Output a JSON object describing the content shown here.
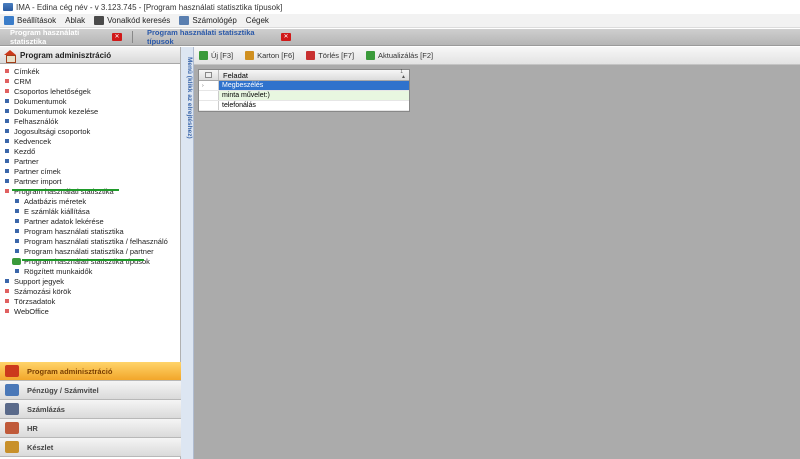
{
  "window": {
    "title": "IMA - Edina cég név - v 3.123.745 - [Program használati statisztika típusok]"
  },
  "menubar": {
    "items": [
      {
        "label": "Beállítások",
        "icon": "wrench-icon",
        "color": "#3b7dc9"
      },
      {
        "label": "Ablak",
        "icon": "",
        "color": ""
      },
      {
        "label": "Vonalkód keresés",
        "icon": "barcode-icon",
        "color": "#4a4a4a"
      },
      {
        "label": "Számológép",
        "icon": "calculator-icon",
        "color": "#5a7fb0"
      },
      {
        "label": "Cégek",
        "icon": "",
        "color": ""
      }
    ]
  },
  "tabs": [
    {
      "label": "Program használati statisztika",
      "active": false
    },
    {
      "label": "Program használati statisztika típusok",
      "active": true
    }
  ],
  "left_panel": {
    "title": "Program adminisztráció",
    "tree": [
      {
        "label": "Címkék",
        "level": 0,
        "bullet": "red"
      },
      {
        "label": "CRM",
        "level": 0,
        "bullet": "red"
      },
      {
        "label": "Csoportos lehetőségek",
        "level": 0,
        "bullet": "red"
      },
      {
        "label": "Dokumentumok",
        "level": 0,
        "bullet": "blue"
      },
      {
        "label": "Dokumentumok kezelése",
        "level": 0,
        "bullet": "blue"
      },
      {
        "label": "Felhasználók",
        "level": 0,
        "bullet": "blue"
      },
      {
        "label": "Jogosultsági csoportok",
        "level": 0,
        "bullet": "blue"
      },
      {
        "label": "Kedvencek",
        "level": 0,
        "bullet": "blue"
      },
      {
        "label": "Kezdő",
        "level": 0,
        "bullet": "blue"
      },
      {
        "label": "Partner",
        "level": 0,
        "bullet": "blue"
      },
      {
        "label": "Partner címek",
        "level": 0,
        "bullet": "blue"
      },
      {
        "label": "Partner import",
        "level": 0,
        "bullet": "blue"
      },
      {
        "label": "Program használati statisztika",
        "level": 0,
        "bullet": "red"
      },
      {
        "label": "Adatbázis méretek",
        "level": 1,
        "bullet": "blue"
      },
      {
        "label": "E számlák kiállítása",
        "level": 1,
        "bullet": "blue"
      },
      {
        "label": "Partner adatok lekérése",
        "level": 1,
        "bullet": "blue"
      },
      {
        "label": "Program használati statisztika",
        "level": 1,
        "bullet": "blue"
      },
      {
        "label": "Program használati statisztika / felhasználó",
        "level": 1,
        "bullet": "blue"
      },
      {
        "label": "Program használati statisztika / partner",
        "level": 1,
        "bullet": "blue"
      },
      {
        "label": "Program használati statisztika típusok",
        "level": 1,
        "bullet": "current"
      },
      {
        "label": "Rögzített munkaidők",
        "level": 1,
        "bullet": "blue"
      },
      {
        "label": "Support jegyek",
        "level": 0,
        "bullet": "blue"
      },
      {
        "label": "Számozási körök",
        "level": 0,
        "bullet": "red"
      },
      {
        "label": "Törzsadatok",
        "level": 0,
        "bullet": "red"
      },
      {
        "label": "WebOffice",
        "level": 0,
        "bullet": "red"
      }
    ]
  },
  "nav_buttons": [
    {
      "label": "Program adminisztráció",
      "icon": "house-icon",
      "color": "#cc3a1c",
      "active": true
    },
    {
      "label": "Pénzügy / Számvitel",
      "icon": "calculator-icon",
      "color": "#4a78b8",
      "active": false
    },
    {
      "label": "Számlázás",
      "icon": "pen-paper-icon",
      "color": "#5a6a8a",
      "active": false
    },
    {
      "label": "HR",
      "icon": "people-icon",
      "color": "#c05a3a",
      "active": false
    },
    {
      "label": "Készlet",
      "icon": "boxes-icon",
      "color": "#c8902a",
      "active": false
    }
  ],
  "side_strip": {
    "label": "Menü (klikk az elrejtéshez)"
  },
  "toolbar": {
    "buttons": [
      {
        "label": "Új [F3]",
        "icon": "new-icon",
        "color": "#3a9a3a"
      },
      {
        "label": "Karton [F6]",
        "icon": "edit-icon",
        "color": "#d09020"
      },
      {
        "label": "Törlés [F7]",
        "icon": "delete-icon",
        "color": "#c83030"
      },
      {
        "label": "Aktualizálás [F2]",
        "icon": "refresh-icon",
        "color": "#3a9a3a"
      }
    ]
  },
  "grid": {
    "column": "Feladat",
    "sort_index": "1",
    "sort_arrow": "▲",
    "current_marker": "›",
    "rows": [
      "Megbeszélés",
      "minta művelet:)",
      "telefonálás"
    ],
    "selected_index": 0
  },
  "colors": {
    "accent": "#2f72cc",
    "active_nav": "#f2a62a",
    "underline": "#1f9a2a"
  }
}
